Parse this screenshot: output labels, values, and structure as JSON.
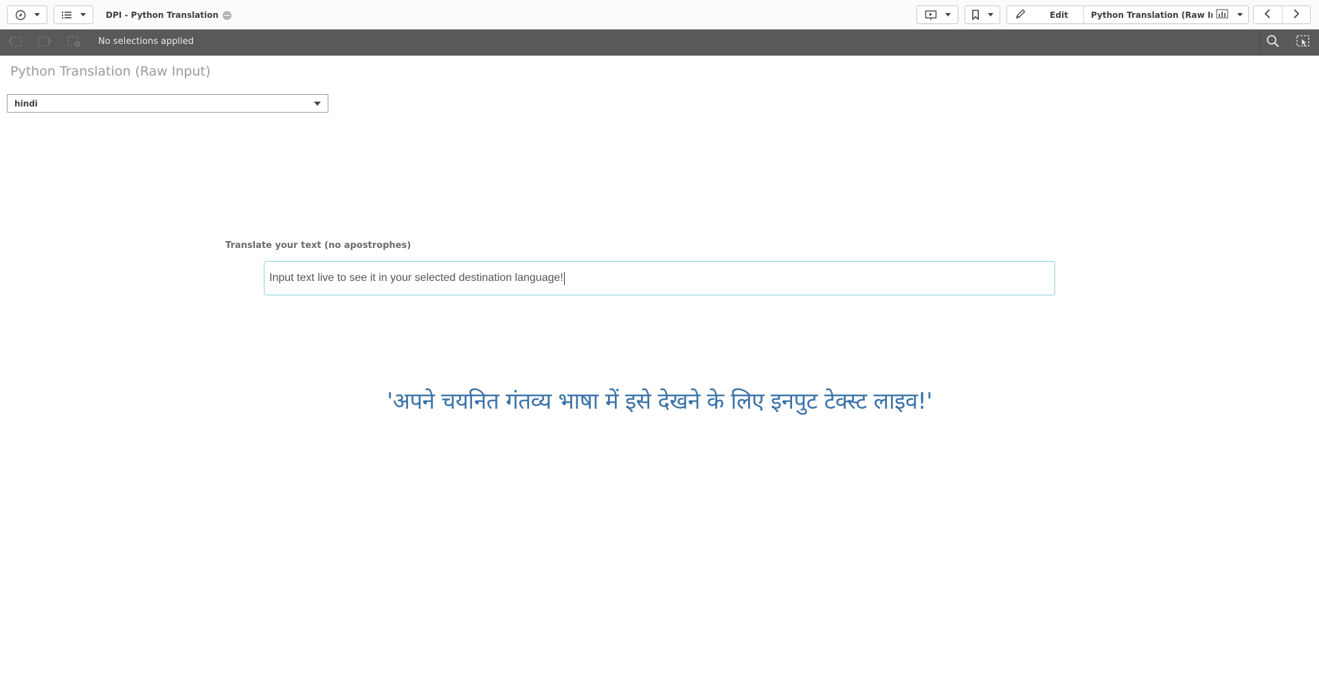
{
  "topbar": {
    "app_title": "DPI - Python Translation",
    "edit_label": "Edit",
    "sheet_name": "Python Translation (Raw Inp..."
  },
  "selection_bar": {
    "status": "No selections applied"
  },
  "sheet": {
    "title": "Python Translation (Raw Input)",
    "language_select": {
      "value": "hindi"
    },
    "input_label": "Translate your text (no apostrophes)",
    "input_value": "Input text live to see it in your selected destination language!",
    "translation_output": "'अपने चयनित गंतव्य भाषा में इसे देखने के लिए इनपुट टेक्स्ट लाइव!'"
  },
  "icons": {
    "navigation": "compass-icon",
    "sheets_list": "list-icon",
    "story": "presentation-icon",
    "bookmark": "bookmark-icon",
    "edit": "pencil-icon",
    "sheet_type": "chart-icon",
    "prev_sheet": "chevron-left-icon",
    "next_sheet": "chevron-right-icon",
    "step_back": "step-back-icon",
    "step_forward": "step-forward-icon",
    "clear_all": "clear-selections-icon",
    "search": "search-icon",
    "selection_tool": "selection-tool-icon"
  },
  "colors": {
    "selection_bar": "#595959",
    "input_border": "#8fd0dc",
    "translation_text": "#3b73a8"
  }
}
